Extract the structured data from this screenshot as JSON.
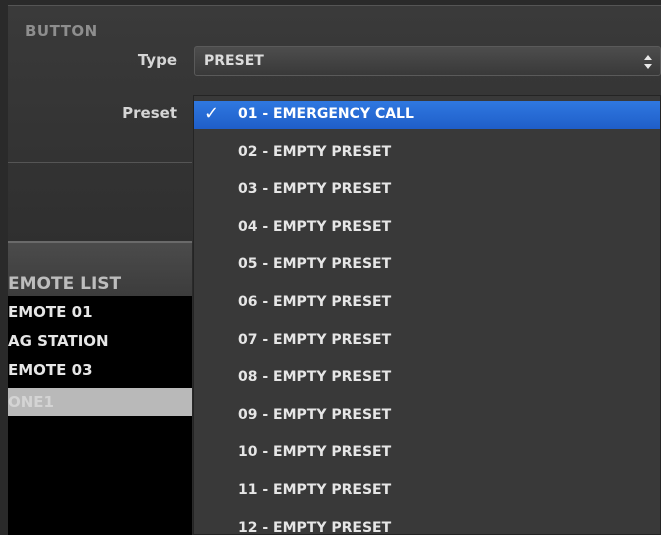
{
  "section": {
    "title": "BUTTON"
  },
  "form": {
    "type_label": "Type",
    "type_value": "PRESET",
    "preset_label": "Preset"
  },
  "remote_list": {
    "title": "EMOTE LIST",
    "items": [
      "EMOTE 01",
      "AG STATION",
      "EMOTE 03",
      "ONE1"
    ],
    "selected_index": 3
  },
  "preset_menu": {
    "selected_index": 0,
    "items": [
      "01 - EMERGENCY CALL",
      "02 - EMPTY PRESET",
      "03 - EMPTY PRESET",
      "04 - EMPTY PRESET",
      "05 - EMPTY PRESET",
      "06 - EMPTY PRESET",
      "07 - EMPTY PRESET",
      "08 - EMPTY PRESET",
      "09 - EMPTY PRESET",
      "10 - EMPTY PRESET",
      "11 - EMPTY PRESET",
      "12 - EMPTY PRESET"
    ]
  },
  "colors": {
    "accent": "#2f78e0",
    "panel": "#2f2f2f",
    "list_background": "#000000"
  }
}
